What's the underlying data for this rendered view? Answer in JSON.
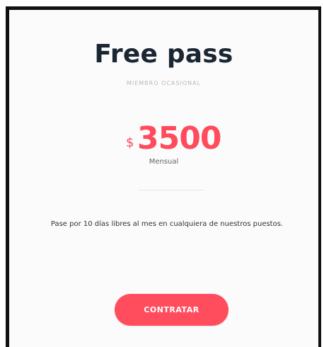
{
  "plan": {
    "title": "Free pass",
    "subtitle": "MIEMBRO OCASIONAL",
    "currency": "$",
    "price": "3500",
    "period": "Mensual",
    "description": "Pase por 10 días libres al mes en cualquiera de nuestros puestos.",
    "cta_label": "CONTRATAR"
  },
  "colors": {
    "accent": "#ff4d5d",
    "title": "#1b2633",
    "muted": "#b6b8bd",
    "border": "#111111"
  }
}
